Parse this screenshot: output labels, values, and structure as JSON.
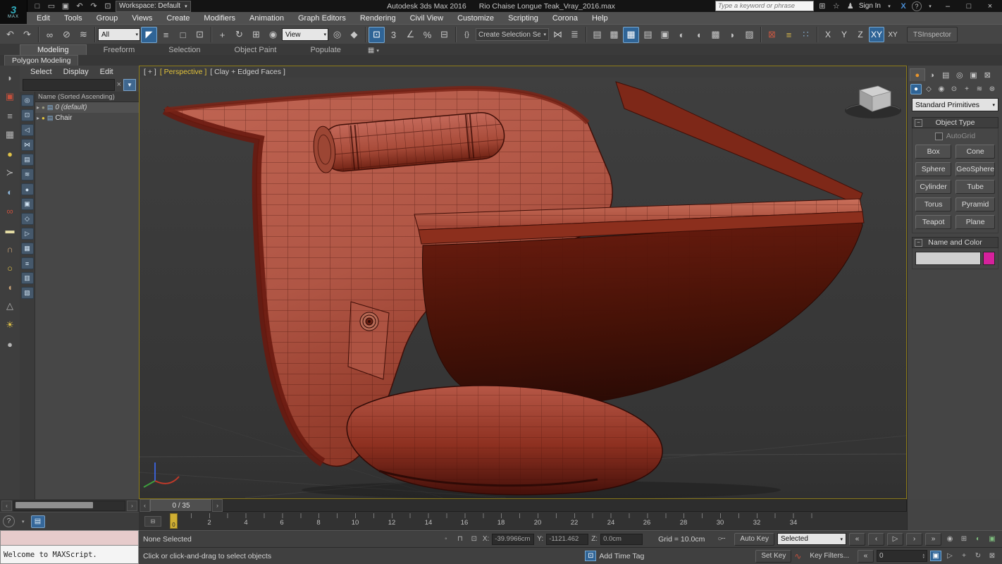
{
  "titlebar": {
    "app": "Autodesk 3ds Max 2016",
    "file": "Rio Chaise Longue Teak_Vray_2016.max",
    "workspace": "Workspace: Default",
    "search_placeholder": "Type a keyword or phrase",
    "sign_in": "Sign In",
    "min": "–",
    "restore": "□",
    "close": "×"
  },
  "menubar": {
    "items": [
      "Edit",
      "Tools",
      "Group",
      "Views",
      "Create",
      "Modifiers",
      "Animation",
      "Graph Editors",
      "Rendering",
      "Civil View",
      "Customize",
      "Scripting",
      "Corona",
      "Help"
    ]
  },
  "toolbar": {
    "filter": "All",
    "coord": "View",
    "selset": "Create Selection Se",
    "axis_x": "X",
    "axis_y": "Y",
    "axis_z": "Z",
    "axis_xy": "XY",
    "axis_xyn": "XY",
    "tsinspector": "TSInspector"
  },
  "ribbon": {
    "tabs": [
      "Modeling",
      "Freeform",
      "Selection",
      "Object Paint",
      "Populate"
    ],
    "subtab": "Polygon Modeling"
  },
  "explorer": {
    "menus": [
      "Select",
      "Display",
      "Edit"
    ],
    "header": "Name (Sorted Ascending)",
    "rows": [
      {
        "label": "0 (default)"
      },
      {
        "label": "Chair"
      }
    ]
  },
  "viewport": {
    "nav": "[ + ]",
    "view": "[ Perspective ]",
    "shading": "[ Clay + Edged Faces ]"
  },
  "panel": {
    "dropdown": "Standard Primitives",
    "object_type_title": "Object Type",
    "autogrid": "AutoGrid",
    "buttons": [
      "Box",
      "Cone",
      "Sphere",
      "GeoSphere",
      "Cylinder",
      "Tube",
      "Torus",
      "Pyramid",
      "Teapot",
      "Plane"
    ],
    "name_color_title": "Name and Color",
    "object_color": "#d6219c"
  },
  "timeline": {
    "slider": "0 / 35",
    "frame": "0",
    "ticks": [
      "0",
      "2",
      "4",
      "6",
      "8",
      "10",
      "12",
      "14",
      "16",
      "18",
      "20",
      "22",
      "24",
      "26",
      "28",
      "30",
      "32",
      "34"
    ]
  },
  "status": {
    "maxscript": "Welcome to MAXScript.",
    "selection": "None Selected",
    "prompt": "Click or click-and-drag to select objects",
    "x_label": "X:",
    "x": "-39.9966cm",
    "y_label": "Y:",
    "y": "-1121.462",
    "z_label": "Z:",
    "z": "0.0cm",
    "grid": "Grid = 10.0cm",
    "add_time_tag": "Add Time Tag",
    "auto_key": "Auto Key",
    "set_key": "Set Key",
    "selected": "Selected",
    "key_filters": "Key Filters...",
    "frame": "0",
    "help": "?"
  },
  "icons": {
    "logo_swirl": "3",
    "logo_max": "MAX",
    "qat": [
      "□",
      "▭",
      "▣",
      "↶",
      "↷",
      "⊡"
    ],
    "dd": "▾",
    "minus": "−",
    "search_side": [
      "⊞",
      "☆",
      "♟"
    ],
    "exchange": "X",
    "helpmark": "?",
    "tb": [
      "↶",
      "↷",
      "∞",
      "⊘",
      "≋",
      "◤",
      "≡",
      "□",
      "⊡",
      "+",
      "↻",
      "⊞",
      "◉",
      "◎",
      "◆",
      "⊡",
      "3",
      "∠",
      "%",
      "⊟",
      "{}",
      "⋈",
      "≣",
      "▤",
      "▩",
      "▦",
      "▤",
      "▣",
      "◐",
      "◖",
      "▩",
      "◗",
      "▨",
      "⊠",
      "≡",
      "∷"
    ],
    "ribbon_cam": "▦",
    "lstrip": [
      "◗",
      "▣",
      "≡",
      "▦",
      "●",
      "≻",
      "◐",
      "∞",
      "▬",
      "∩",
      "○",
      "◖",
      "△",
      "☀",
      "●"
    ],
    "sstrip": [
      "◎",
      "⊡",
      "◁",
      "⋈",
      "▤",
      "≋",
      "●",
      "▣",
      "◇",
      "▷",
      "▦",
      "≡",
      "▥",
      "▧"
    ],
    "tri": "▸",
    "bulb": "●",
    "layers": "▤",
    "funnel": "▼",
    "clear": "×",
    "cptabs": [
      "●",
      "◑",
      "▤",
      "◎",
      "▣",
      "⊠"
    ],
    "cpsub": [
      "●",
      "◇",
      "◉",
      "⊙",
      "+",
      "≋",
      "⊛"
    ],
    "scroll_l": "‹",
    "scroll_r": "›",
    "track": "⊟",
    "pin": "◦",
    "lock": "⊓",
    "absrel": "⊡",
    "isolate": "⊡",
    "key": "○╌",
    "curve": "∿",
    "play": [
      "«",
      "‹",
      "▷",
      "›",
      "»"
    ],
    "anim_aux": [
      "◉",
      "⊞",
      "◐",
      "▣"
    ],
    "goto_start": "«",
    "nav2": [
      "▣",
      "▷",
      "+",
      "↻",
      "⊠"
    ],
    "spin_u": "▴",
    "spin_d": "▾"
  }
}
